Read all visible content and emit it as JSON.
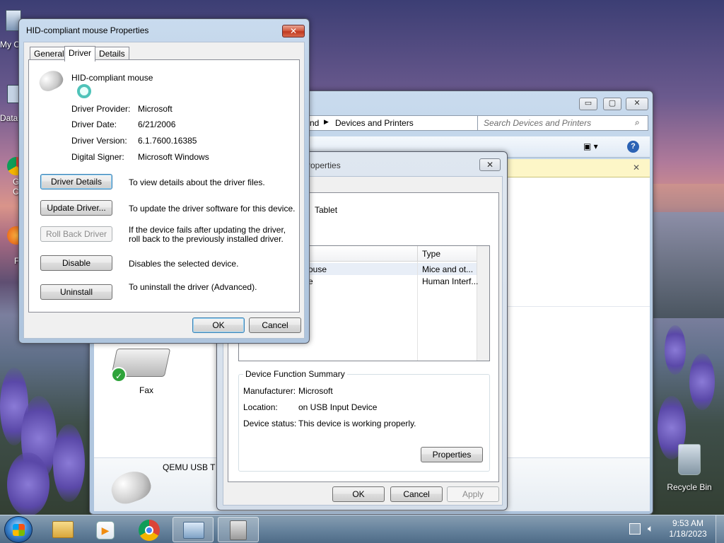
{
  "desktop": {
    "icons": [
      {
        "label": "My C"
      },
      {
        "label": "Data"
      },
      {
        "label": "G"
      },
      {
        "label": "C"
      },
      {
        "label": "F"
      }
    ],
    "recycle_bin": "Recycle Bin"
  },
  "explorer": {
    "breadcrumb_prefix": "nd",
    "breadcrumb_current": "Devices and Printers",
    "search_placeholder": "Search Devices and Printers",
    "fax_label": "Fax",
    "qemu_label": "QEMU USB T"
  },
  "tablet_dialog": {
    "title_partial": "roperties",
    "device_name_partial": "Tablet",
    "list": {
      "col_type": "Type",
      "rows": [
        {
          "name": "ouse",
          "type": "Mice and ot..."
        },
        {
          "name": "e",
          "type": "Human Interf..."
        }
      ]
    },
    "summary": {
      "group_title": "Device Function Summary",
      "manufacturer_label": "Manufacturer:",
      "manufacturer_value": "Microsoft",
      "location_label": "Location:",
      "location_value": "on USB Input Device",
      "status_label": "Device status:",
      "status_value": "This device is working properly.",
      "properties_button": "Properties"
    },
    "buttons": {
      "ok": "OK",
      "cancel": "Cancel",
      "apply": "Apply"
    }
  },
  "mouse_dialog": {
    "title": "HID-compliant mouse Properties",
    "tabs": [
      "General",
      "Driver",
      "Details"
    ],
    "active_tab": "Driver",
    "device_name": "HID-compliant mouse",
    "info": [
      {
        "label": "Driver Provider:",
        "value": "Microsoft"
      },
      {
        "label": "Driver Date:",
        "value": "6/21/2006"
      },
      {
        "label": "Driver Version:",
        "value": "6.1.7600.16385"
      },
      {
        "label": "Digital Signer:",
        "value": "Microsoft Windows"
      }
    ],
    "actions": [
      {
        "button": "Driver Details",
        "desc": "To view details about the driver files.",
        "disabled": false
      },
      {
        "button": "Update Driver...",
        "desc": "To update the driver software for this device.",
        "disabled": false
      },
      {
        "button": "Roll Back Driver",
        "desc": "If the device fails after updating the driver, roll back to the previously installed driver.",
        "disabled": true
      },
      {
        "button": "Disable",
        "desc": "Disables the selected device.",
        "disabled": false
      },
      {
        "button": "Uninstall",
        "desc": "To uninstall the driver (Advanced).",
        "disabled": false
      }
    ],
    "buttons": {
      "ok": "OK",
      "cancel": "Cancel"
    }
  },
  "taskbar": {
    "time": "9:53 AM",
    "date": "1/18/2023"
  }
}
